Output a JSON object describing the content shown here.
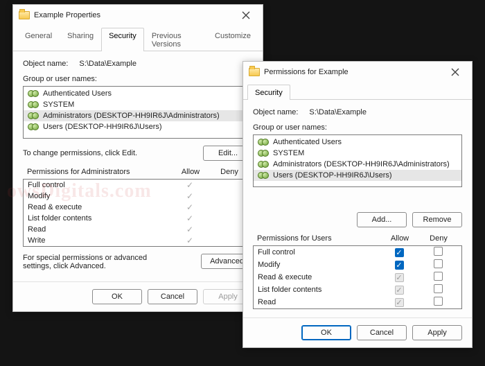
{
  "watermark": "owsDigitals.com",
  "win1": {
    "title": "Example Properties",
    "tabs": [
      "General",
      "Sharing",
      "Security",
      "Previous Versions",
      "Customize"
    ],
    "active_tab": "Security",
    "object_label": "Object name:",
    "object_value": "S:\\Data\\Example",
    "group_label": "Group or user names:",
    "groups": [
      "Authenticated Users",
      "SYSTEM",
      "Administrators (DESKTOP-HH9IR6J\\Administrators)",
      "Users (DESKTOP-HH9IR6J\\Users)"
    ],
    "selected_group_index": 2,
    "edit_hint": "To change permissions, click Edit.",
    "edit_btn": "Edit...",
    "perm_header": "Permissions for Administrators",
    "allow_col": "Allow",
    "deny_col": "Deny",
    "perms": [
      {
        "name": "Full control",
        "allow": true,
        "deny": false
      },
      {
        "name": "Modify",
        "allow": true,
        "deny": false
      },
      {
        "name": "Read & execute",
        "allow": true,
        "deny": false
      },
      {
        "name": "List folder contents",
        "allow": true,
        "deny": false
      },
      {
        "name": "Read",
        "allow": true,
        "deny": false
      },
      {
        "name": "Write",
        "allow": true,
        "deny": false
      }
    ],
    "adv_hint": "For special permissions or advanced settings, click Advanced.",
    "adv_btn": "Advanced",
    "ok": "OK",
    "cancel": "Cancel",
    "apply": "Apply"
  },
  "win2": {
    "title": "Permissions for Example",
    "tabs": [
      "Security"
    ],
    "active_tab": "Security",
    "object_label": "Object name:",
    "object_value": "S:\\Data\\Example",
    "group_label": "Group or user names:",
    "groups": [
      "Authenticated Users",
      "SYSTEM",
      "Administrators (DESKTOP-HH9IR6J\\Administrators)",
      "Users (DESKTOP-HH9IR6J\\Users)"
    ],
    "selected_group_index": 3,
    "add_btn": "Add...",
    "remove_btn": "Remove",
    "perm_header": "Permissions for Users",
    "allow_col": "Allow",
    "deny_col": "Deny",
    "perms": [
      {
        "name": "Full control",
        "allow": "checked",
        "deny": "empty"
      },
      {
        "name": "Modify",
        "allow": "checked",
        "deny": "empty"
      },
      {
        "name": "Read & execute",
        "allow": "inherited",
        "deny": "empty"
      },
      {
        "name": "List folder contents",
        "allow": "inherited",
        "deny": "empty"
      },
      {
        "name": "Read",
        "allow": "inherited",
        "deny": "empty"
      }
    ],
    "ok": "OK",
    "cancel": "Cancel",
    "apply": "Apply"
  }
}
